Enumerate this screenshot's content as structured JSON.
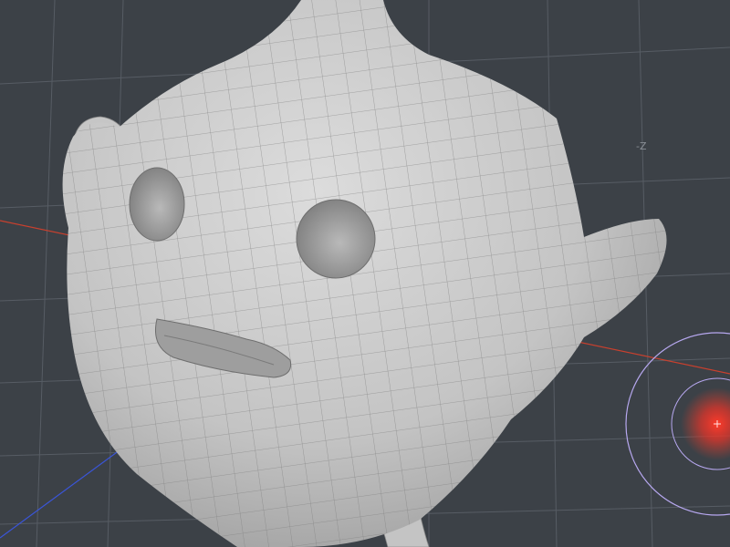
{
  "viewport": {
    "axis_label": "-Z",
    "colors": {
      "background": "#3c4147",
      "grid": "#5a6068",
      "x_axis": "#c8402e",
      "z_axis": "#3a55d8",
      "mesh_fill": "#c9c9c9",
      "mesh_wire": "#7d7d7d",
      "brush_outer": "#b7a8f0",
      "brush_core": "#ff3a2a"
    }
  },
  "model": {
    "name_icon": "character-mesh-icon"
  },
  "brush": {
    "icon": "sculpt-brush-cursor-icon"
  }
}
